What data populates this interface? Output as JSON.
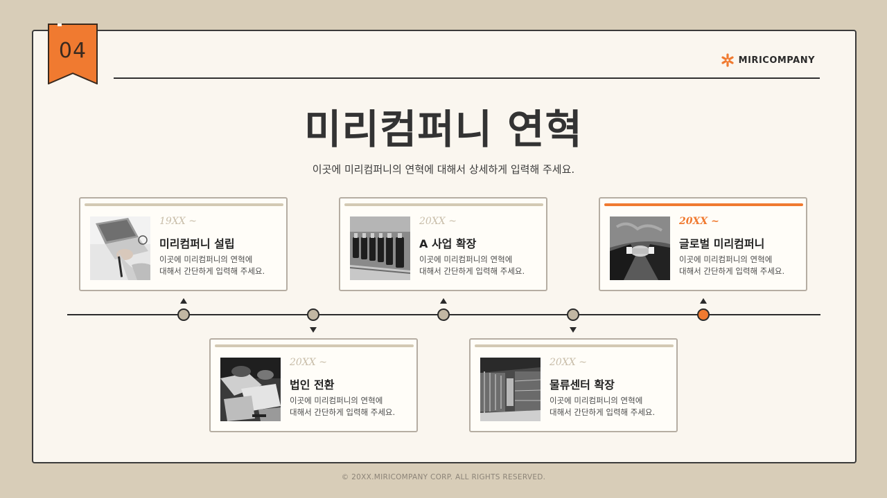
{
  "section_number": "04",
  "logo": {
    "text": "MIRICOMPANY",
    "icon": "asterisk-logo-icon",
    "color": "#f07a30"
  },
  "title": "미리컴퍼니 연혁",
  "subtitle": "이곳에 미리컴퍼니의 연혁에 대해서 상세하게 입력해 주세요.",
  "colors": {
    "accent": "#f07a30",
    "beige": "#d3c9b3",
    "background": "#faf6ef",
    "outer": "#d8cdb8"
  },
  "timeline": [
    {
      "year": "19XX ~",
      "title": "미리컴퍼니 설립",
      "desc_line1": "이곳에 미리컴퍼니의 연혁에",
      "desc_line2": "대해서 간단하게 입력해 주세요.",
      "image": "laptop-photo",
      "position": "above",
      "accent": false
    },
    {
      "year": "20XX ~",
      "title": "법인 전환",
      "desc_line1": "이곳에 미리컴퍼니의 연혁에",
      "desc_line2": "대해서 간단하게 입력해 주세요.",
      "image": "documents-photo",
      "position": "below",
      "accent": false
    },
    {
      "year": "20XX ~",
      "title": "A 사업 확장",
      "desc_line1": "이곳에 미리컴퍼니의 연혁에",
      "desc_line2": "대해서 간단하게 입력해 주세요.",
      "image": "bottles-photo",
      "position": "above",
      "accent": false
    },
    {
      "year": "20XX ~",
      "title": "물류센터 확장",
      "desc_line1": "이곳에 미리컴퍼니의 연혁에",
      "desc_line2": "대해서 간단하게 입력해 주세요.",
      "image": "warehouse-photo",
      "position": "below",
      "accent": false
    },
    {
      "year": "20XX ~",
      "title": "글로벌 미리컴퍼니",
      "desc_line1": "이곳에 미리컴퍼니의 연혁에",
      "desc_line2": "대해서 간단하게 입력해 주세요.",
      "image": "handshake-photo",
      "position": "above",
      "accent": true
    }
  ],
  "footer": "© 20XX.MIRICOMPANY CORP. ALL RIGHTS RESERVED."
}
